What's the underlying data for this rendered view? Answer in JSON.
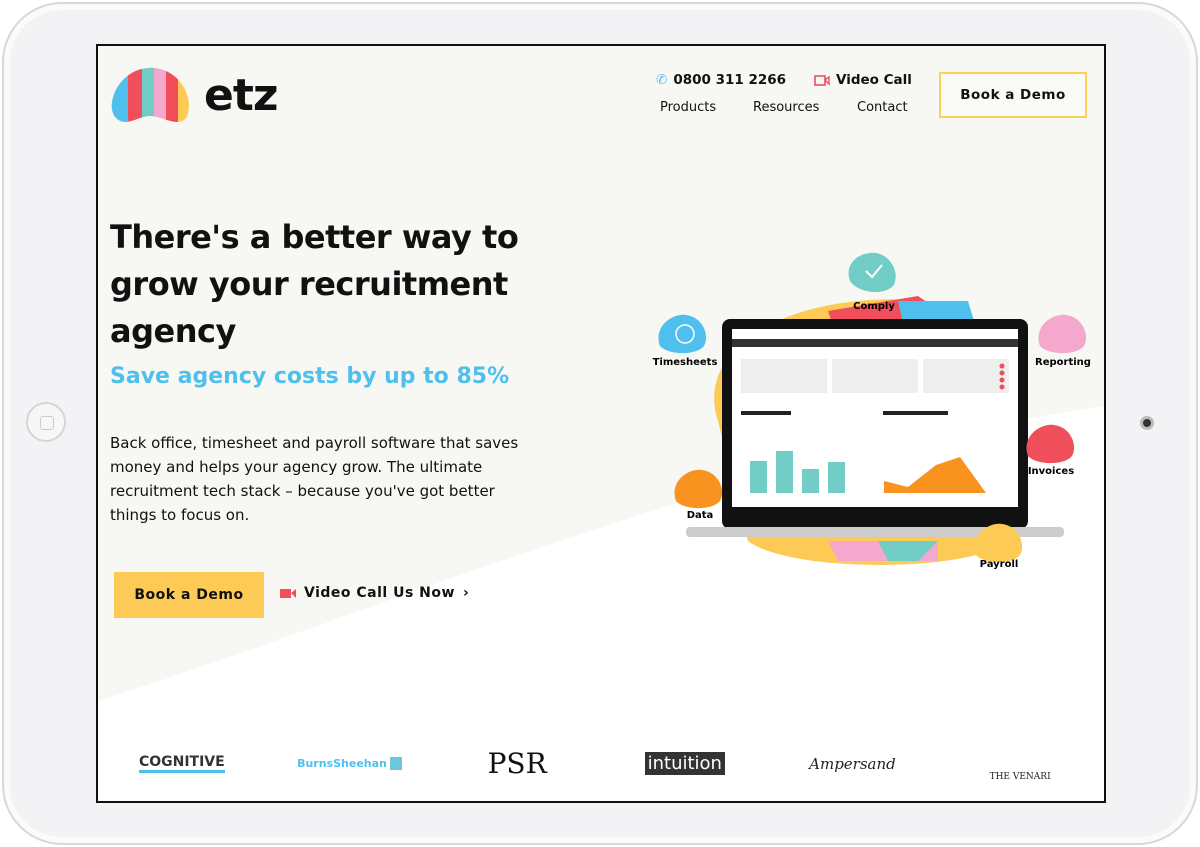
{
  "brand": {
    "name": "etz"
  },
  "header": {
    "phone": "0800 311 2266",
    "video_call": "Video Call",
    "nav": [
      "Products",
      "Resources",
      "Contact"
    ],
    "book_demo": "Book a Demo"
  },
  "hero": {
    "title": "There's a better way to grow your recruitment agency",
    "subtitle": "Save agency costs by up to 85%",
    "body": "Back office, timesheet and payroll software that saves money and helps your agency grow. The ultimate recruitment tech stack – because you've got better things to focus on.",
    "cta": "Book a Demo",
    "video_link": "Video Call Us Now"
  },
  "illustration": {
    "features": [
      "Comply",
      "Timesheets",
      "Reporting",
      "Invoices",
      "Data",
      "Payroll"
    ]
  },
  "clients": [
    "COGNITIVE",
    "BurnsSheehan",
    "PSR",
    "intuition",
    "Ampersand",
    "THE VENARI"
  ],
  "colors": {
    "yellow": "#fdcb55",
    "blue": "#4fc0ee",
    "red": "#ef4e5a",
    "teal": "#72cdc6",
    "pink": "#f3a8cc",
    "orange": "#f7931e"
  }
}
